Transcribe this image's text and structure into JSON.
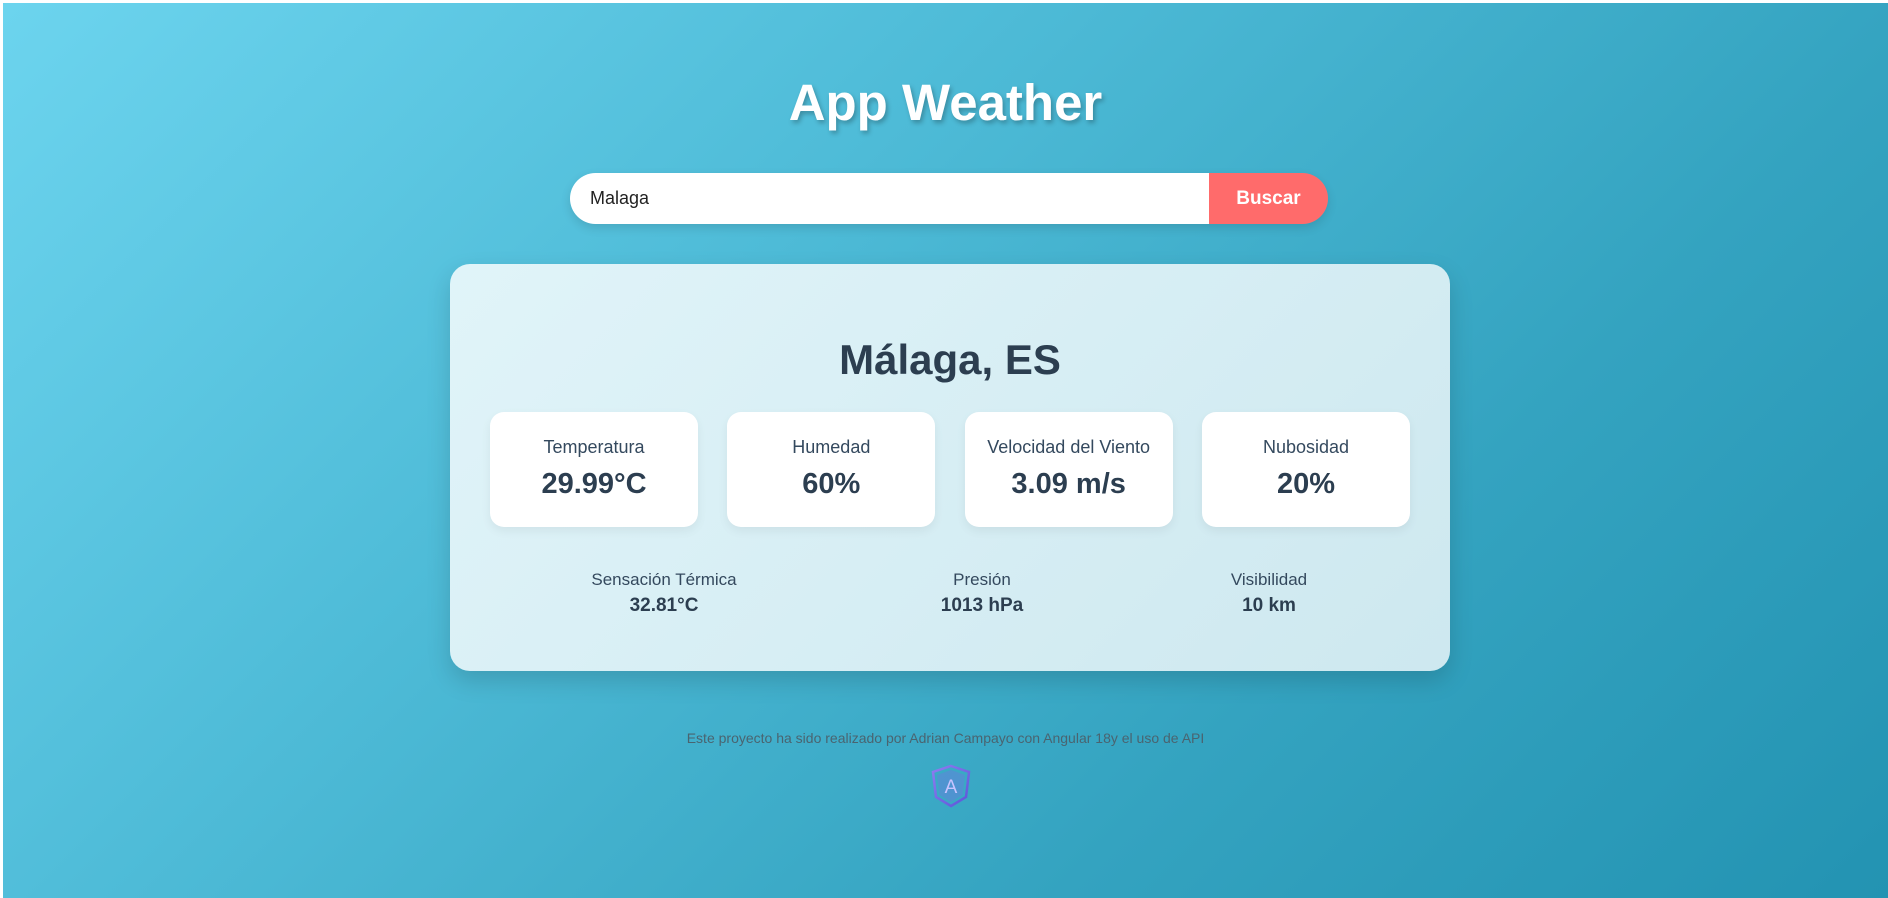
{
  "app": {
    "title": "App Weather"
  },
  "search": {
    "value": "Malaga",
    "button_label": "Buscar"
  },
  "weather": {
    "city": "Málaga, ES",
    "metrics": [
      {
        "label": "Temperatura",
        "value": "29.99°C"
      },
      {
        "label": "Humedad",
        "value": "60%"
      },
      {
        "label": "Velocidad del Viento",
        "value": "3.09 m/s"
      },
      {
        "label": "Nubosidad",
        "value": "20%"
      }
    ],
    "extras": [
      {
        "label": "Sensación Térmica",
        "value": "32.81°C"
      },
      {
        "label": "Presión",
        "value": "1013 hPa"
      },
      {
        "label": "Visibilidad",
        "value": "10 km"
      }
    ]
  },
  "footer": {
    "text": "Este proyecto ha sido realizado por Adrian Campayo con Angular 18y el uso de API",
    "logo_icon": "angular-logo-icon",
    "logo_letter": "A"
  },
  "colors": {
    "accent": "#ff6b6b",
    "text_dark": "#2c3e50",
    "bg_start": "#6cd4ee",
    "bg_end": "#2393b2"
  }
}
